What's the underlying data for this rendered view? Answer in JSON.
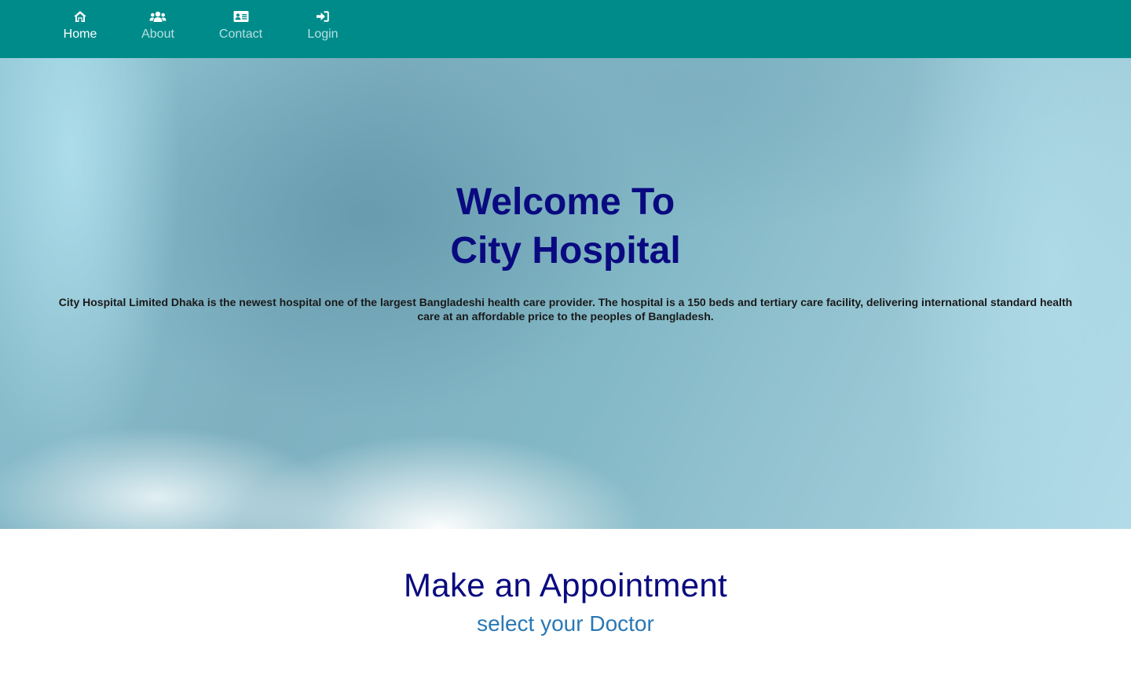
{
  "nav": {
    "items": [
      {
        "label": "Home",
        "icon": "home-icon",
        "active": true
      },
      {
        "label": "About",
        "icon": "users-icon",
        "active": false
      },
      {
        "label": "Contact",
        "icon": "address-card-icon",
        "active": false
      },
      {
        "label": "Login",
        "icon": "sign-in-icon",
        "active": false
      }
    ]
  },
  "hero": {
    "title_line1": "Welcome To",
    "title_line2": "City Hospital",
    "description": "City Hospital Limited Dhaka is the newest hospital one of the largest Bangladeshi health care provider. The hospital is a 150 beds and tertiary care facility, delivering international standard health care at an affordable price to the peoples of Bangladesh."
  },
  "appointment": {
    "title": "Make an Appointment",
    "subtitle": "select your Doctor"
  },
  "colors": {
    "nav_background": "#008b8b",
    "nav_active_text": "#ffffff",
    "nav_inactive_text": "#b9e0e0",
    "hero_title": "#0a0a80",
    "appointment_title": "#0a0a80",
    "appointment_subtitle": "#2a78b4"
  }
}
